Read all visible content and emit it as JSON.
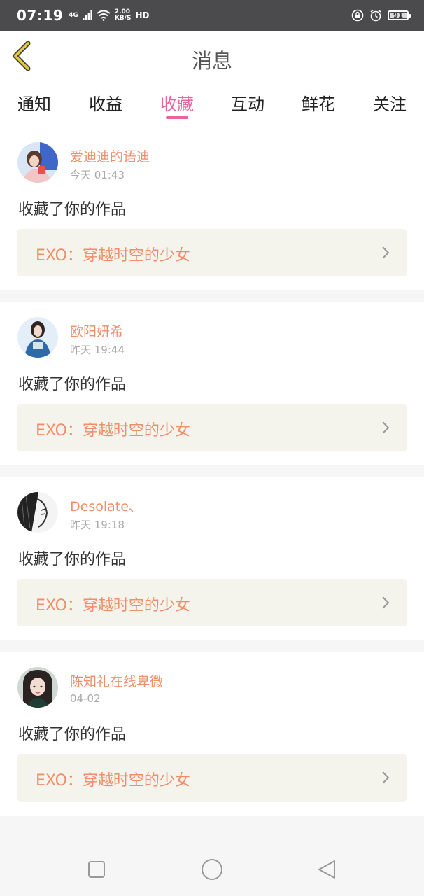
{
  "status_bar": {
    "time": "07:19",
    "network": "4G",
    "speed_value": "2.00",
    "speed_unit": "KB/S",
    "hd": "HD",
    "battery": "91",
    "battery_level": 0.91
  },
  "header": {
    "title": "消息"
  },
  "tabs": [
    {
      "label": "通知",
      "active": false
    },
    {
      "label": "收益",
      "active": false
    },
    {
      "label": "收藏",
      "active": true
    },
    {
      "label": "互动",
      "active": false
    },
    {
      "label": "鲜花",
      "active": false
    },
    {
      "label": "关注",
      "active": false
    }
  ],
  "messages": [
    {
      "username": "爱迪迪的语迪",
      "time": "今天 01:43",
      "action": "收藏了你的作品",
      "work_title": "EXO：穿越时空的少女"
    },
    {
      "username": "欧阳妍希",
      "time": "昨天 19:44",
      "action": "收藏了你的作品",
      "work_title": "EXO：穿越时空的少女"
    },
    {
      "username": "Desolate、",
      "time": "昨天 19:18",
      "action": "收藏了你的作品",
      "work_title": "EXO：穿越时空的少女"
    },
    {
      "username": "陈知礼在线卑微",
      "time": "04-02",
      "action": "收藏了你的作品",
      "work_title": "EXO：穿越时空的少女"
    }
  ],
  "icons": {
    "back": "back-arrow-icon",
    "chevron": "chevron-right-icon",
    "nav_recent": "square-icon",
    "nav_home": "circle-icon",
    "nav_back": "triangle-back-icon"
  },
  "colors": {
    "accent": "#e8649c",
    "username": "#ef8e6a",
    "back_arrow": "#e6c93a",
    "work_box": "#f4f4ec"
  }
}
